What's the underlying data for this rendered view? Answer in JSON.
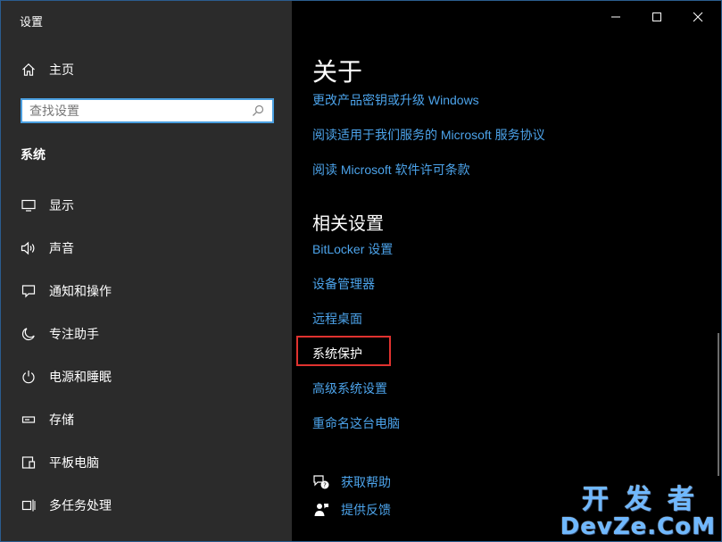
{
  "window": {
    "title": "设置",
    "controls": {
      "minimize": "minimize",
      "maximize": "maximize",
      "close": "close"
    }
  },
  "sidebar": {
    "home_label": "主页",
    "search_placeholder": "查找设置",
    "section_title": "系统",
    "items": [
      {
        "label": "显示",
        "icon": "display-icon"
      },
      {
        "label": "声音",
        "icon": "sound-icon"
      },
      {
        "label": "通知和操作",
        "icon": "notification-icon"
      },
      {
        "label": "专注助手",
        "icon": "moon-icon"
      },
      {
        "label": "电源和睡眠",
        "icon": "power-icon"
      },
      {
        "label": "存储",
        "icon": "storage-icon"
      },
      {
        "label": "平板电脑",
        "icon": "tablet-icon"
      },
      {
        "label": "多任务处理",
        "icon": "multitask-icon"
      }
    ]
  },
  "main": {
    "about_title": "关于",
    "about_links": [
      "更改产品密钥或升级 Windows",
      "阅读适用于我们服务的 Microsoft 服务协议",
      "阅读 Microsoft 软件许可条款"
    ],
    "related_title": "相关设置",
    "related_links": [
      "BitLocker 设置",
      "设备管理器",
      "远程桌面",
      "系统保护",
      "高级系统设置",
      "重命名这台电脑"
    ],
    "help_label": "获取帮助",
    "feedback_label": "提供反馈"
  },
  "watermark": {
    "line1": "开发者",
    "line2": "DevZe.CoM"
  },
  "colors": {
    "accent": "#4ca3ea",
    "sidebar_bg": "#2b2b2b",
    "highlight": "#e0322f"
  }
}
